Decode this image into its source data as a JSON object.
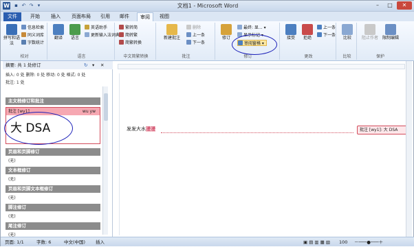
{
  "window": {
    "title": "文档1 - Microsoft Word"
  },
  "tabs": [
    "文件",
    "开始",
    "插入",
    "页面布局",
    "引用",
    "邮件",
    "审阅",
    "视图"
  ],
  "ribbon": {
    "proofing": {
      "label": "校对",
      "spell": "拼写和语法",
      "research": "信息检索",
      "thesaurus": "同义词库",
      "wordcount": "字数统计"
    },
    "language": {
      "label": "语言",
      "translate": "翻译",
      "lang": "语言",
      "eng1": "英语助手",
      "eng2": "更新输入法词典"
    },
    "chinese": {
      "label": "中文简繁转换",
      "t2s": "繁转简",
      "s2t": "简转繁",
      "conv": "简繁转换"
    },
    "comments": {
      "label": "批注",
      "new": "新建批注",
      "del": "删除",
      "prev": "上一条",
      "next": "下一条"
    },
    "tracking": {
      "label": "修订",
      "track": "修订",
      "final": "最终: 显...",
      "showmarkup": "显示标记",
      "pane": "审阅窗格"
    },
    "changes": {
      "label": "更改",
      "accept": "接受",
      "reject": "拒绝",
      "prev": "上一条",
      "next": "下一条"
    },
    "compare": {
      "label": "比较",
      "compare": "比较"
    },
    "protect": {
      "label": "保护",
      "block": "阻止作者",
      "restrict": "限制编辑"
    }
  },
  "pane": {
    "summary": "摘要: 共 1 处修订",
    "line1": "插入: 0 处  删除: 0 处  移动: 0 处  格式: 0 处",
    "line2": "批注: 1 处",
    "sections": [
      "主文档修订和批注",
      "页眉和页脚修订",
      "文本框修订",
      "页眉和页脚文本框修订",
      "脚注修订",
      "尾注修订"
    ],
    "none": "(无)",
    "comment_header": "批注 [wy1]",
    "comment_user": "wu yw",
    "comment_text": "大 DSA"
  },
  "document": {
    "text_plain": "发发大水",
    "text_marked": "漫漫",
    "balloon": "批注 [wy1]: 大 DSA"
  },
  "status": {
    "page": "页面: 1/1",
    "words": "字数: 6",
    "lang": "中文(中国)",
    "mode": "插入",
    "zoom": "100"
  }
}
